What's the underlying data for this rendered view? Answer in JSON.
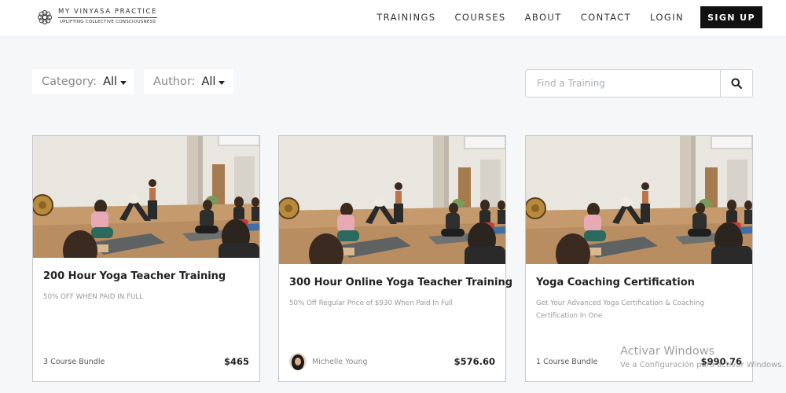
{
  "brand": {
    "title": "MY VINYASA PRACTICE",
    "tagline": "UPLIFTING COLLECTIVE CONSCIOUSNESS",
    "icon": "lotus-logo-icon"
  },
  "nav": {
    "items": [
      "TRAININGS",
      "COURSES",
      "ABOUT",
      "CONTACT",
      "LOGIN"
    ],
    "signup_label": "SIGN UP"
  },
  "filters": {
    "category_label": "Category:",
    "category_value": "All",
    "author_label": "Author:",
    "author_value": "All"
  },
  "search": {
    "placeholder": "Find a Training",
    "icon": "search-icon"
  },
  "cards": [
    {
      "title": "200 Hour Yoga Teacher Training",
      "subtitle": "50% OFF WHEN PAID IN FULL",
      "footer_left": "3 Course Bundle",
      "price": "$465"
    },
    {
      "title": "300 Hour Online Yoga Teacher Training",
      "subtitle": "50% Off Regular Price of $930 When Paid In Full",
      "author": "Michelle Young",
      "price": "$576.60"
    },
    {
      "title": "Yoga Coaching Certification",
      "subtitle": "Get Your Advanced Yoga Certification & Coaching Certification In One",
      "footer_left": "1 Course Bundle",
      "price": "$990.76"
    }
  ],
  "watermark": {
    "title": "Activar Windows",
    "subtitle": "Ve a Configuración para activar Windows."
  },
  "colors": {
    "background": "#f6f7f9",
    "signup_bg": "#111111",
    "card_border": "#c8c8c8"
  }
}
